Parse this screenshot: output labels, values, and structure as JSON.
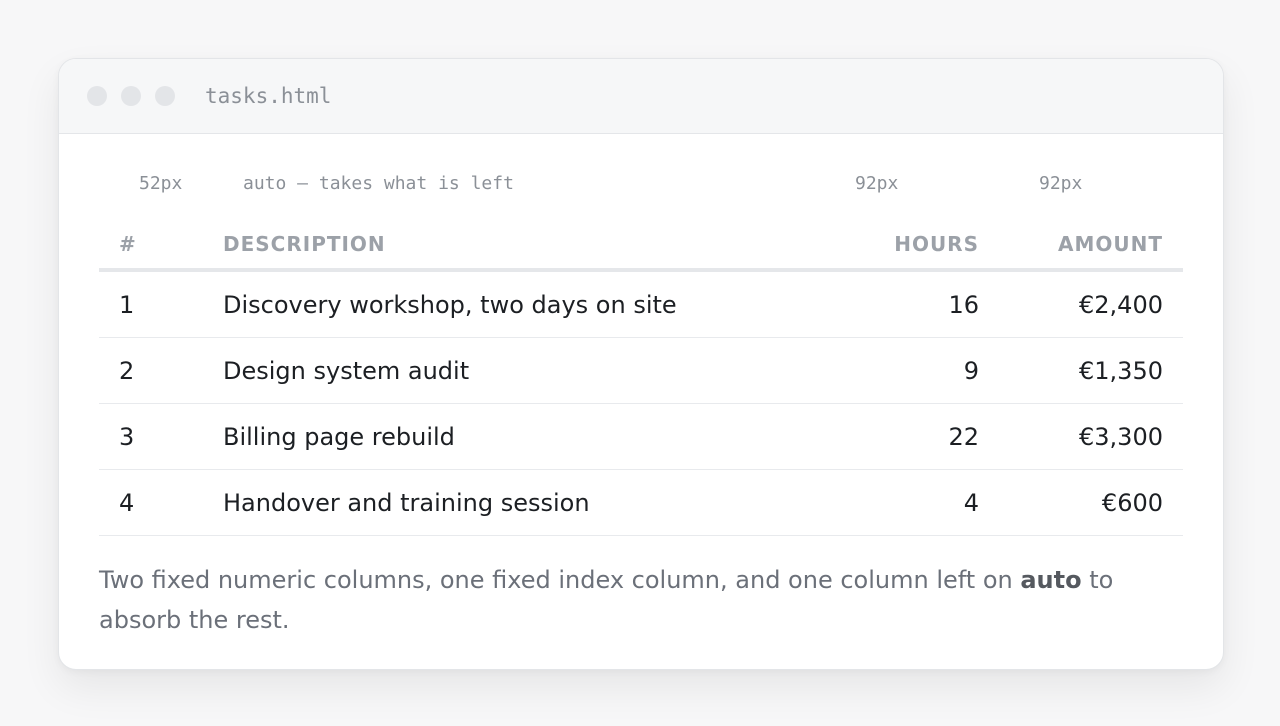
{
  "window": {
    "filename": "tasks.html"
  },
  "column_widths": {
    "index": "52px",
    "description": "auto — takes what is left",
    "hours": "92px",
    "amount": "92px"
  },
  "table": {
    "headers": [
      "#",
      "DESCRIPTION",
      "HOURS",
      "AMOUNT"
    ],
    "rows": [
      {
        "index": "1",
        "description": "Discovery workshop, two days on site",
        "hours": "16",
        "amount": "€2,400"
      },
      {
        "index": "2",
        "description": "Design system audit",
        "hours": "9",
        "amount": "€1,350"
      },
      {
        "index": "3",
        "description": "Billing page rebuild",
        "hours": "22",
        "amount": "€3,300"
      },
      {
        "index": "4",
        "description": "Handover and training session",
        "hours": "4",
        "amount": "€600"
      }
    ]
  },
  "note": {
    "before": "Two fixed numeric columns, one fixed index column, and one column left on ",
    "emphasis": "auto",
    "after": " to absorb the rest."
  }
}
